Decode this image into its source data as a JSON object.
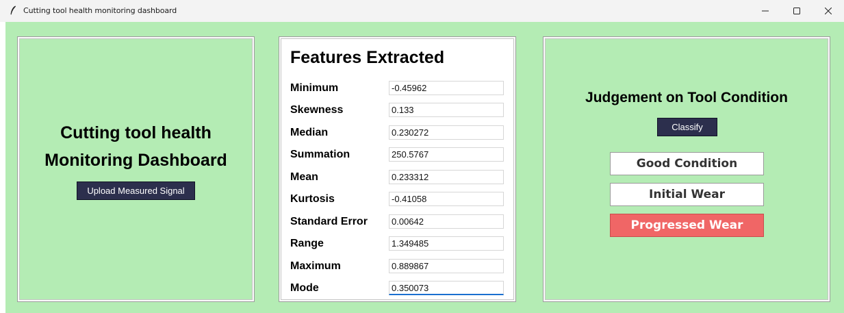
{
  "window": {
    "title": "Cutting tool health monitoring dashboard",
    "controls": [
      "minimize-icon",
      "maximize-icon",
      "close-icon"
    ]
  },
  "colors": {
    "background": "#b4ecb4",
    "button": "#2c2f4d",
    "progressed_wear": "#f06666"
  },
  "left_panel": {
    "title_line1": "Cutting tool health",
    "title_line2": "Monitoring Dashboard",
    "upload_label": "Upload Measured Signal"
  },
  "features": {
    "title": "Features Extracted",
    "rows": [
      {
        "label": "Minimum",
        "value": "-0.45962"
      },
      {
        "label": "Skewness",
        "value": "0.133"
      },
      {
        "label": "Median",
        "value": "0.230272"
      },
      {
        "label": "Summation",
        "value": "250.5767"
      },
      {
        "label": "Mean",
        "value": "0.233312"
      },
      {
        "label": "Kurtosis",
        "value": "-0.41058"
      },
      {
        "label": "Standard Error",
        "value": "0.00642"
      },
      {
        "label": "Range",
        "value": "1.349485"
      },
      {
        "label": "Maximum",
        "value": "0.889867"
      },
      {
        "label": "Mode",
        "value": "0.350073"
      }
    ]
  },
  "judgement": {
    "title": "Judgement on Tool Condition",
    "classify_label": "Classify",
    "good": "Good Condition",
    "initial": "Initial Wear",
    "progressed": "Progressed Wear"
  }
}
